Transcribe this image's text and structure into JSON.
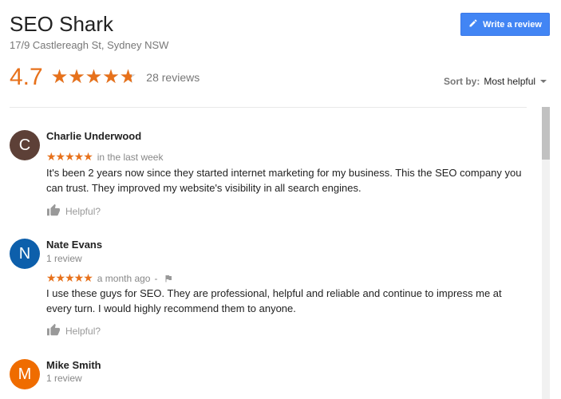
{
  "place": {
    "name": "SEO Shark",
    "address": "17/9 Castlereagh St, Sydney NSW"
  },
  "write_review_label": "Write a review",
  "summary": {
    "average": "4.7",
    "rating_value": 4.7,
    "reviews_count": "28 reviews"
  },
  "sort": {
    "label": "Sort by:",
    "value": "Most helpful"
  },
  "reviews": [
    {
      "initial": "C",
      "avatar_color": "#5d4037",
      "name": "Charlie Underwood",
      "stars": "★★★★★",
      "rating": 5,
      "time": "in the last week",
      "text": "It's been 2 years now since they started internet marketing for my business. This the SEO company you can trust. They improved my website's visibility in all search engines.",
      "helpful": "Helpful?"
    },
    {
      "initial": "N",
      "avatar_color": "#0d5fab",
      "name": "Nate Evans",
      "sub": "1 review",
      "stars": "★★★★★",
      "rating": 5,
      "time": "a month ago",
      "separator": "-",
      "text": "I use these guys for SEO. They are professional, helpful and reliable and continue to impress me at every turn. I would highly recommend them to anyone.",
      "helpful": "Helpful?"
    },
    {
      "initial": "M",
      "avatar_color": "#ef6c00",
      "name": "Mike Smith",
      "sub": "1 review"
    }
  ],
  "colors": {
    "accent": "#e7711b",
    "button": "#4285f4"
  },
  "icons": [
    "pencil-icon",
    "thumbs-up-icon",
    "flag-icon",
    "chevron-down-icon"
  ]
}
